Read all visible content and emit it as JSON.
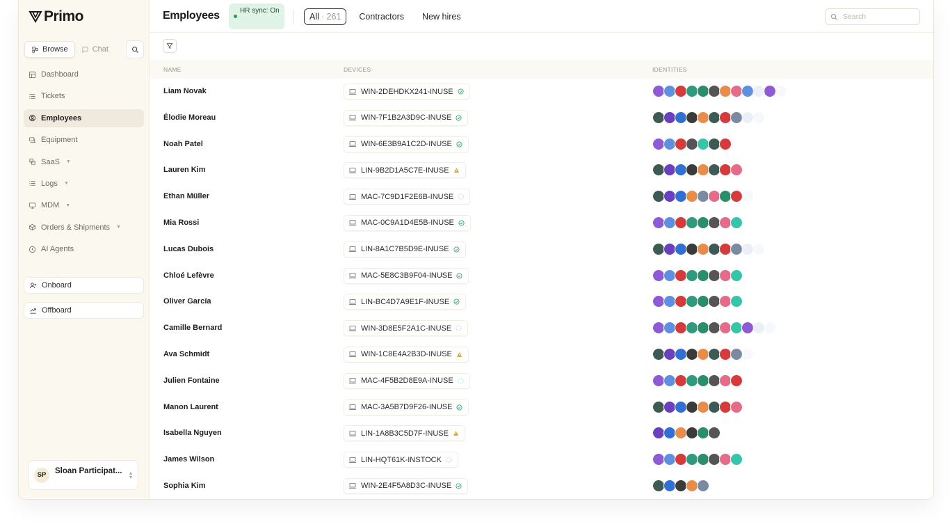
{
  "brand": {
    "name": "Primo"
  },
  "sidebar": {
    "modes": [
      {
        "label": "Browse",
        "active": true
      },
      {
        "label": "Chat",
        "active": false
      }
    ],
    "items": [
      {
        "label": "Dashboard",
        "icon": "dashboard-icon",
        "active": false,
        "caret": false
      },
      {
        "label": "Tickets",
        "icon": "tickets-icon",
        "active": false,
        "caret": false
      },
      {
        "label": "Employees",
        "icon": "employees-icon",
        "active": true,
        "caret": false
      },
      {
        "label": "Equipment",
        "icon": "equipment-icon",
        "active": false,
        "caret": false
      },
      {
        "label": "SaaS",
        "icon": "saas-icon",
        "active": false,
        "caret": true
      },
      {
        "label": "Logs",
        "icon": "logs-icon",
        "active": false,
        "caret": true
      },
      {
        "label": "MDM",
        "icon": "mdm-icon",
        "active": false,
        "caret": true
      },
      {
        "label": "Orders & Shipments",
        "icon": "orders-icon",
        "active": false,
        "caret": true
      },
      {
        "label": "AI Agents",
        "icon": "ai-agents-icon",
        "active": false,
        "caret": false
      }
    ],
    "actions": {
      "onboard": "Onboard",
      "offboard": "Offboard"
    },
    "user": {
      "initials": "SP",
      "name": "Sloan Participat...",
      "avatar_color": "#f4ecd6"
    }
  },
  "header": {
    "title": "Employees",
    "sync_badge": "HR sync: On",
    "tabs": [
      {
        "label": "All",
        "count": "· 261",
        "active": true
      },
      {
        "label": "Contractors",
        "count": "",
        "active": false
      },
      {
        "label": "New hires",
        "count": "",
        "active": false
      }
    ],
    "search_placeholder": "Search"
  },
  "table": {
    "columns": {
      "name": "NAME",
      "devices": "DEVICES",
      "identities": "IDENTITIES"
    },
    "rows": [
      {
        "name": "Liam Novak",
        "device": "WIN-2DEHDKX241-INUSE",
        "status": "ok",
        "ids": "pscatnfhs_p_"
      },
      {
        "name": "Élodie Moreau",
        "device": "WIN-7F1B2A3D9C-INUSE",
        "status": "ok",
        "ids": "gzmdfgcb__"
      },
      {
        "name": "Noah Patel",
        "device": "WIN-6E3B9A1C2D-INUSE",
        "status": "ok",
        "ids": "pscnkgc"
      },
      {
        "name": "Lauren Kim",
        "device": "LIN-9B2D1A5C7E-INUSE",
        "status": "warn",
        "ids": "gzmdfgch"
      },
      {
        "name": "Ethan Müller",
        "device": "MAC-7C9D1F2E6B-INUSE",
        "status": "pending",
        "ids": "gzmfbhtc_"
      },
      {
        "name": "Mia Rossi",
        "device": "MAC-0C9A1D4E5B-INUSE",
        "status": "ok",
        "ids": "pscatnhk"
      },
      {
        "name": "Lucas Dubois",
        "device": "LIN-8A1C7B5D9E-INUSE",
        "status": "ok",
        "ids": "gzmdfgcb__"
      },
      {
        "name": "Chloé Lefèvre",
        "device": "MAC-5E8C3B9F04-INUSE",
        "status": "ok",
        "ids": "pscatnhk"
      },
      {
        "name": "Oliver García",
        "device": "LIN-BC4D7A9E1F-INUSE",
        "status": "ok",
        "ids": "pscatnhk"
      },
      {
        "name": "Camille Bernard",
        "device": "WIN-3D8E5F2A1C-INUSE",
        "status": "pending",
        "ids": "pscatnhkp__"
      },
      {
        "name": "Ava Schmidt",
        "device": "WIN-1C8E4A2B3D-INUSE",
        "status": "warn",
        "ids": "gzmdfgcb_"
      },
      {
        "name": "Julien Fontaine",
        "device": "MAC-4F5B2D8E9A-INUSE",
        "status": "pending",
        "ids": "pscatnhc"
      },
      {
        "name": "Manon Laurent",
        "device": "MAC-3A5B7D9F26-INUSE",
        "status": "ok",
        "ids": "gzmdfgch"
      },
      {
        "name": "Isabella Nguyen",
        "device": "LIN-1A8B3C5D7F-INUSE",
        "status": "warn",
        "ids": "zmfdtn"
      },
      {
        "name": "James Wilson",
        "device": "LIN-HQT61K-INSTOCK",
        "status": "pending",
        "ids": "pscatnhk"
      },
      {
        "name": "Sophia Kim",
        "device": "WIN-2E4F5A8D3C-INUSE",
        "status": "ok",
        "ids": "gmdfb"
      }
    ]
  },
  "identity_apps": {
    "p": {
      "color": "#8e5ad6",
      "icon": "identity-purple-icon"
    },
    "s": {
      "color": "#5f8fe0",
      "icon": "identity-blue-stripes-icon"
    },
    "c": {
      "color": "#d63a3a",
      "icon": "identity-red-a-icon"
    },
    "a": {
      "color": "#2f9a7d",
      "icon": "identity-teal-a-icon"
    },
    "t": {
      "color": "#2a8d6c",
      "icon": "identity-green-icon"
    },
    "n": {
      "color": "#555555",
      "icon": "identity-notion-icon"
    },
    "f": {
      "color": "#e98c4a",
      "icon": "identity-orange-icon"
    },
    "h": {
      "color": "#e56b8a",
      "icon": "identity-pink-icon"
    },
    "k": {
      "color": "#36c5a8",
      "icon": "identity-slack-icon"
    },
    "g": {
      "color": "#3d5a55",
      "icon": "identity-dark-green-icon"
    },
    "z": {
      "color": "#6a3fc0",
      "icon": "identity-violet-icon"
    },
    "m": {
      "color": "#2f6fd6",
      "icon": "identity-dropbox-icon"
    },
    "d": {
      "color": "#3b3b3b",
      "icon": "identity-github-icon"
    },
    "b": {
      "color": "#7a8aa0",
      "icon": "identity-slate-icon"
    },
    "_": {
      "color": "#b9c7e8",
      "icon": "identity-faded-icon"
    }
  },
  "colors": {
    "sync_bg": "#dff4e6",
    "ok": "#34a26a",
    "warn": "#e0a526",
    "pending": "#9bd7b5"
  }
}
